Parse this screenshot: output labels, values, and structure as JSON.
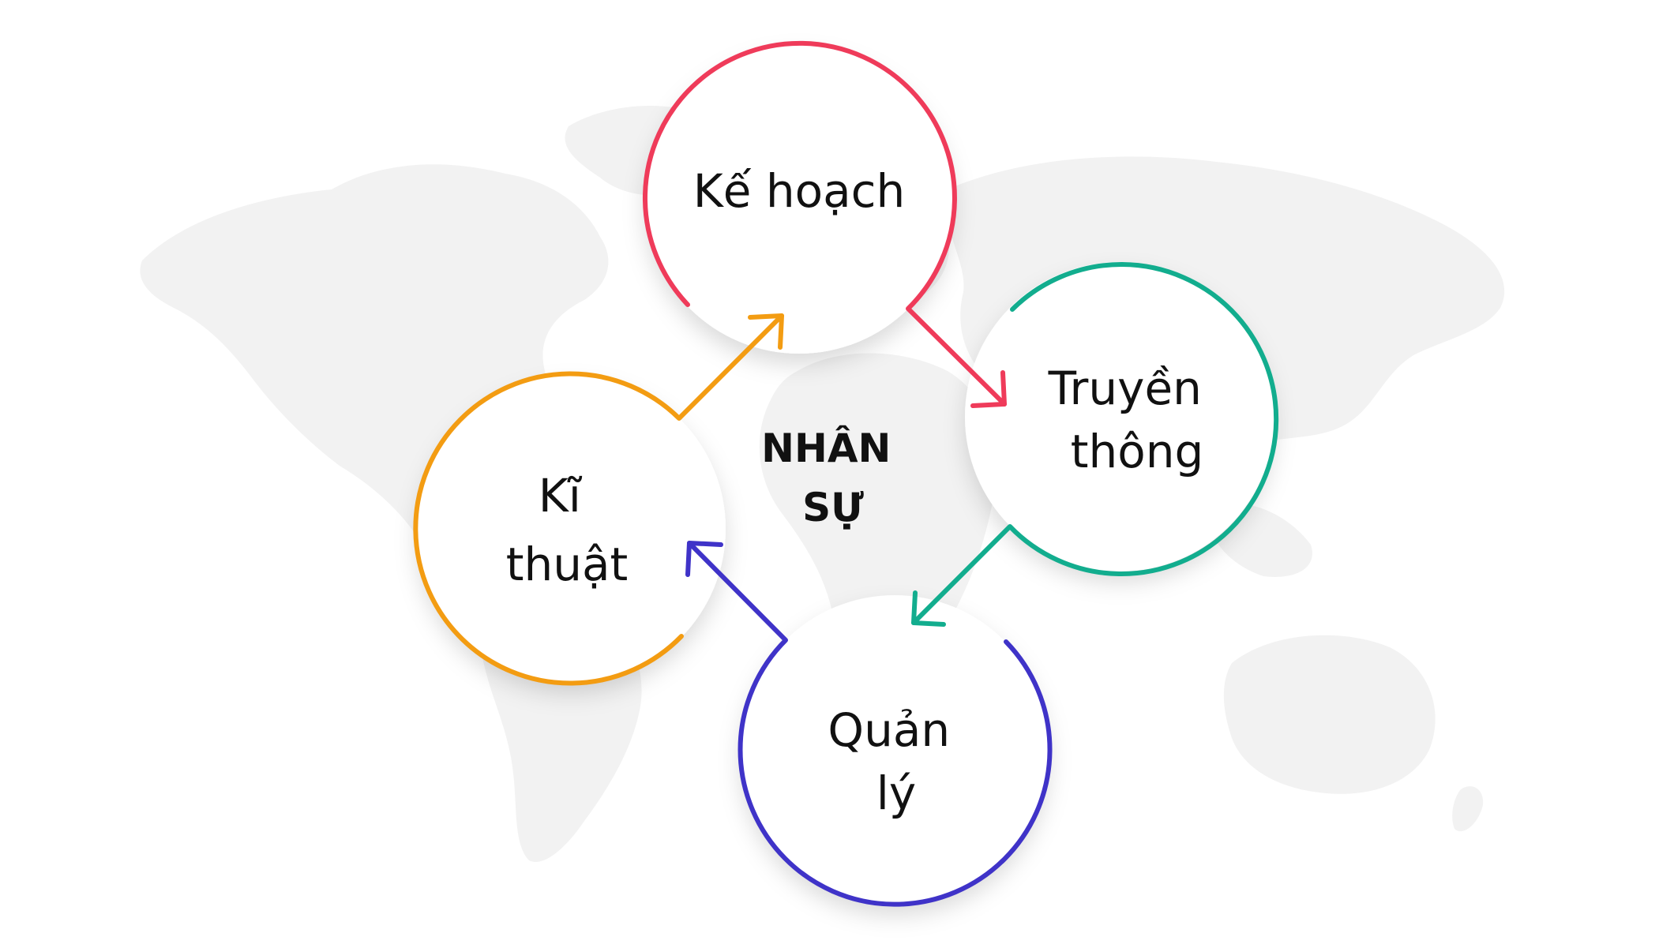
{
  "center": {
    "line1": "NHÂN",
    "line2": "SỰ"
  },
  "nodes": {
    "ke_hoach": {
      "line1": "Kế hoạch",
      "color": "#ef3b5a"
    },
    "truyen_thong": {
      "line1": "Truyền",
      "line2": "thông",
      "color": "#12ad8e"
    },
    "quan_ly": {
      "line1": "Quản",
      "line2": "lý",
      "color": "#3f33c8"
    },
    "ki_thuat": {
      "line1": "Kĩ",
      "line2": "thuật",
      "color": "#f39c12"
    }
  },
  "background": {
    "map_color": "#f2f2f2",
    "icon": "world-map-icon"
  }
}
